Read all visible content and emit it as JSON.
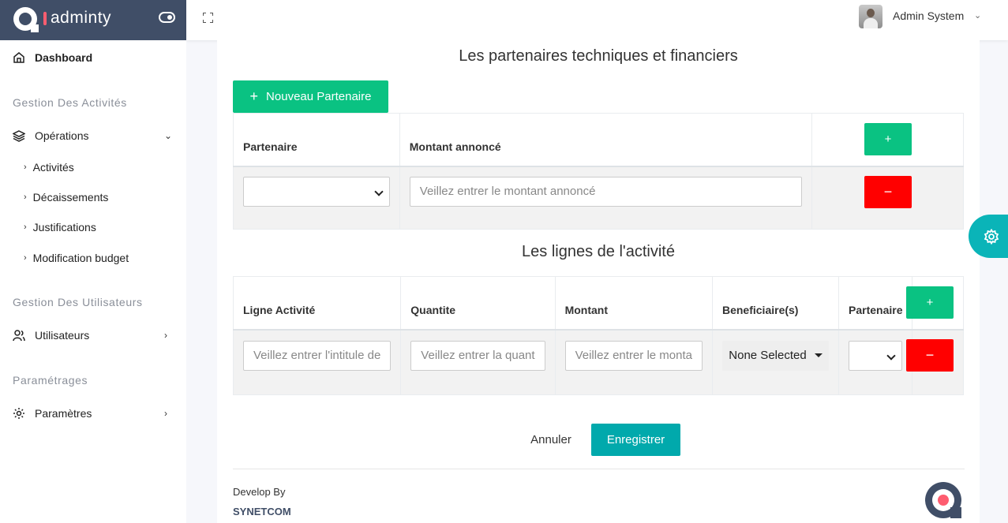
{
  "brand": {
    "name": "adminty",
    "colors": {
      "navbar": "#404e67",
      "accent": "#fe5d70"
    }
  },
  "header": {
    "user_name": "Admin System",
    "fullscreen_icon": "expand-icon",
    "dropdown_icon": "chevron-down-icon"
  },
  "sidebar": {
    "dashboard": "Dashboard",
    "sections": [
      "Gestion Des Activités",
      "Gestion Des Utilisateurs",
      "Paramétrages"
    ],
    "operations": "Opérations",
    "operations_sub": [
      "Activités",
      "Décaissements",
      "Justifications",
      "Modification budget"
    ],
    "users": "Utilisateurs",
    "settings": "Paramètres"
  },
  "partners": {
    "title": "Les partenaires techniques et financiers",
    "new_button": "Nouveau Partenaire",
    "columns": [
      "Partenaire",
      "Montant annoncé"
    ],
    "amount_placeholder": "Veillez entrer le montant annoncé",
    "partner_value": ""
  },
  "lines": {
    "title": "Les lignes de l'activité",
    "columns": [
      "Ligne Activité",
      "Quantite",
      "Montant",
      "Beneficiaire(s)",
      "Partenaire"
    ],
    "placeholders": {
      "line": "Veillez entrer l'intitule de",
      "quantity": "Veillez entrer la quant",
      "amount": "Veillez entrer le monta"
    },
    "beneficiaries_value": "None Selected"
  },
  "actions": {
    "cancel": "Annuler",
    "save": "Enregistrer",
    "add": "+",
    "remove": "−"
  },
  "footer": {
    "developed_by": "Develop By",
    "company": "SYNETCOM"
  },
  "colors": {
    "green": "#0ac282",
    "red": "#ff0000",
    "teal": "#01a9ac"
  }
}
